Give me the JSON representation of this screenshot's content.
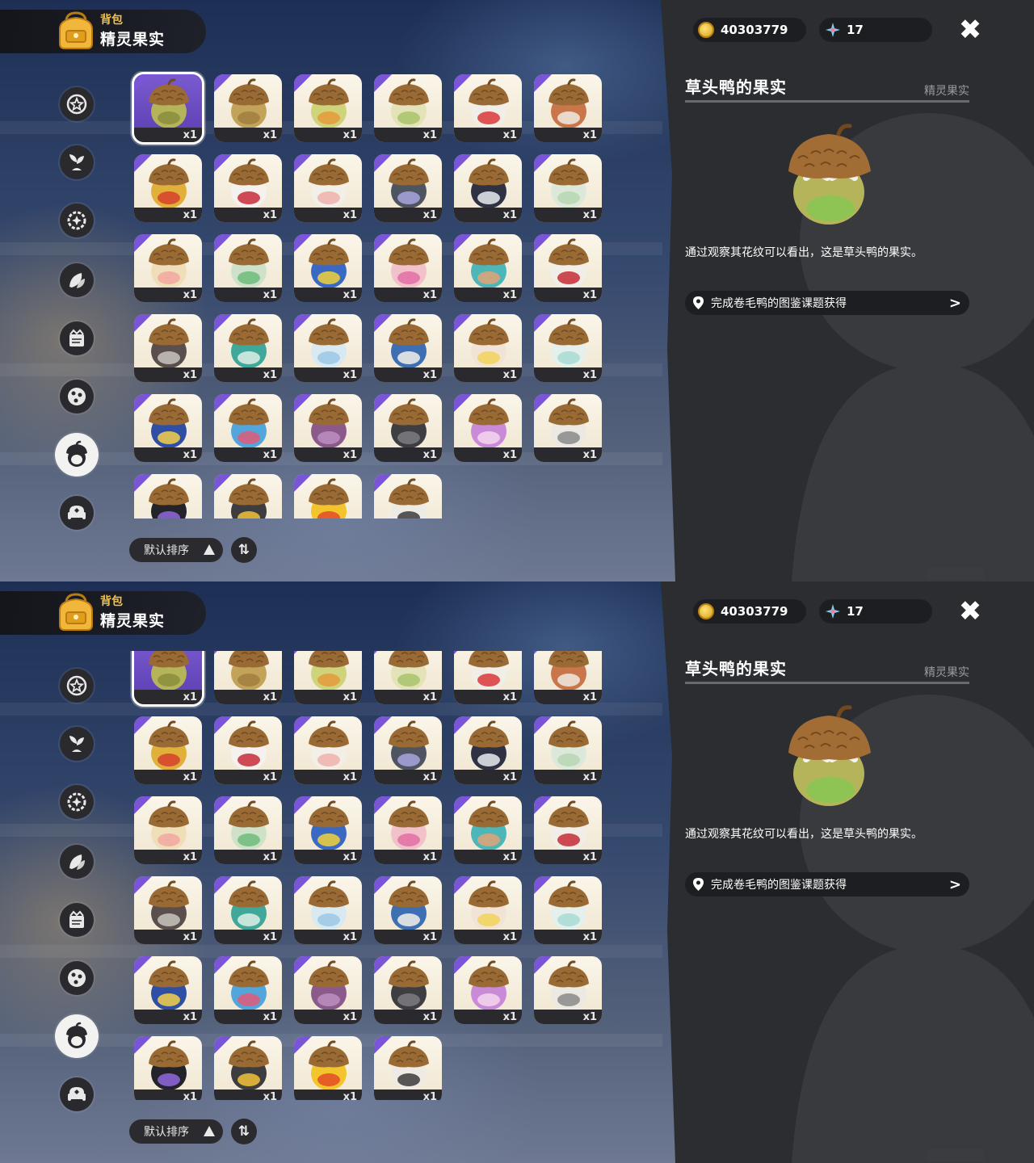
{
  "header": {
    "subtitle": "背包",
    "title": "精灵果实"
  },
  "currency": {
    "coins": "40303779",
    "gems": "17"
  },
  "categories": [
    {
      "icon": "star-badge-icon"
    },
    {
      "icon": "leaf-sprout-icon"
    },
    {
      "icon": "sparkle-gear-icon"
    },
    {
      "icon": "leaves-icon"
    },
    {
      "icon": "crown-scroll-icon"
    },
    {
      "icon": "ball-icon"
    },
    {
      "icon": "acorn-icon",
      "active": true
    },
    {
      "icon": "armchair-icon"
    }
  ],
  "grid": {
    "items": [
      {
        "color": "#b6b45a",
        "accent": "#8a8d3c",
        "qty": "x1",
        "selected": true
      },
      {
        "color": "#c3a35a",
        "accent": "#a17f3f",
        "qty": "x1"
      },
      {
        "color": "#cfd37a",
        "accent": "#e49a3a",
        "qty": "x1"
      },
      {
        "color": "#e3e2b8",
        "accent": "#a8c46a",
        "qty": "x1"
      },
      {
        "color": "#f1eee8",
        "accent": "#d9383a",
        "qty": "x1"
      },
      {
        "color": "#c9764a",
        "accent": "#f0ebe2",
        "qty": "x1"
      },
      {
        "color": "#e0b03a",
        "accent": "#d5412d",
        "qty": "x1"
      },
      {
        "color": "#f4f1ee",
        "accent": "#c72e3a",
        "qty": "x1"
      },
      {
        "color": "#f2eee8",
        "accent": "#eeb1aa",
        "qty": "x1"
      },
      {
        "color": "#4e5560",
        "accent": "#a9a6de",
        "qty": "x1"
      },
      {
        "color": "#2f3243",
        "accent": "#e8ecef",
        "qty": "x1"
      },
      {
        "color": "#dce9da",
        "accent": "#b8d6b0",
        "qty": "x1"
      },
      {
        "color": "#efdfb9",
        "accent": "#f2a7a0",
        "qty": "x1"
      },
      {
        "color": "#cfe2c9",
        "accent": "#6dbb79",
        "qty": "x1"
      },
      {
        "color": "#3a69c4",
        "accent": "#f0d13a",
        "qty": "x1"
      },
      {
        "color": "#f1c2c9",
        "accent": "#e26fa5",
        "qty": "x1"
      },
      {
        "color": "#4db6b8",
        "accent": "#e2a477",
        "qty": "x1"
      },
      {
        "color": "#f1eee8",
        "accent": "#c52c36",
        "qty": "x1"
      },
      {
        "color": "#5a4f4d",
        "accent": "#c7c3bd",
        "qty": "x1"
      },
      {
        "color": "#3fa89a",
        "accent": "#dfeee6",
        "qty": "x1"
      },
      {
        "color": "#d8e9f2",
        "accent": "#9cc8e6",
        "qty": "x1"
      },
      {
        "color": "#3d6fb2",
        "accent": "#f3f1ea",
        "qty": "x1"
      },
      {
        "color": "#f1e4d6",
        "accent": "#f1d25a",
        "qty": "x1"
      },
      {
        "color": "#e5f0ec",
        "accent": "#a9dbd5",
        "qty": "x1"
      },
      {
        "color": "#2f4fa4",
        "accent": "#f3d04a",
        "qty": "x1"
      },
      {
        "color": "#52a6dc",
        "accent": "#e05a7a",
        "qty": "x1"
      },
      {
        "color": "#8c5a8a",
        "accent": "#bb8fc0",
        "qty": "x1"
      },
      {
        "color": "#3e3e42",
        "accent": "#7b7b80",
        "qty": "x1"
      },
      {
        "color": "#c98ad8",
        "accent": "#f5d6ef",
        "qty": "x1"
      },
      {
        "color": "#ece9e3",
        "accent": "#8a8a8a",
        "qty": "x1"
      },
      {
        "color": "#23242a",
        "accent": "#8f67dd",
        "qty": "x1"
      },
      {
        "color": "#3d3d3f",
        "accent": "#f2c23a",
        "qty": "x1"
      },
      {
        "color": "#f2c52c",
        "accent": "#e44a24",
        "qty": "x1"
      },
      {
        "color": "#eeeae4",
        "accent": "#3c3c3c",
        "qty": "x1"
      }
    ]
  },
  "sort": {
    "label": "默认排序",
    "order_icon": "⇅"
  },
  "detail": {
    "title": "草头鸭的果实",
    "category": "精灵果实",
    "description": "通过观察其花纹可以看出，这是草头鸭的果实。",
    "source": "完成卷毛鸭的图鉴课题获得",
    "item_color": "#b6b45a",
    "item_accent": "#8dc453"
  }
}
